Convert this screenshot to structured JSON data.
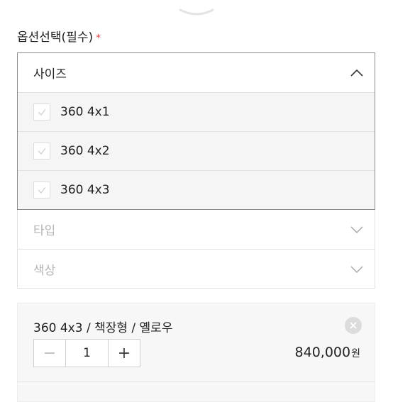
{
  "section": {
    "label": "옵션선택(필수)",
    "required_mark": "*"
  },
  "size_dropdown": {
    "label": "사이즈",
    "options": [
      {
        "label": "360 4x1",
        "checked": true
      },
      {
        "label": "360 4x2",
        "checked": true
      },
      {
        "label": "360 4x3",
        "checked": true
      }
    ]
  },
  "type_dropdown": {
    "label": "타입"
  },
  "color_dropdown": {
    "label": "색상"
  },
  "cart_item": {
    "title": "360 4x3 / 책장형 / 옐로우",
    "quantity": "1",
    "minus": "−",
    "plus": "+",
    "price": "840,000",
    "price_unit": "원"
  },
  "colors": {
    "required": "#e64545",
    "border_active": "#8a8a8a",
    "option_bg": "#f5f5f5"
  }
}
